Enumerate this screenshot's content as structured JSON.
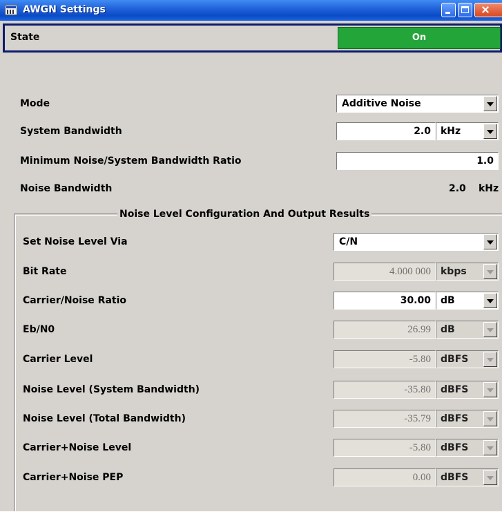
{
  "window": {
    "title": "AWGN Settings",
    "icon": "app-window-icon",
    "controls": [
      "minimize-icon",
      "maximize-icon",
      "close-icon"
    ]
  },
  "state": {
    "label": "State",
    "value": "On",
    "color": "#23a53a"
  },
  "mode": {
    "label": "Mode",
    "value": "Additive Noise"
  },
  "system_bandwidth": {
    "label": "System Bandwidth",
    "value": "2.0",
    "unit": "kHz"
  },
  "min_ratio": {
    "label": "Minimum Noise/System Bandwidth Ratio",
    "value": "1.0"
  },
  "noise_bandwidth": {
    "label": "Noise Bandwidth",
    "value": "2.0",
    "unit": "kHz"
  },
  "group": {
    "title": "Noise Level Configuration And Output Results",
    "set_noise_level_via": {
      "label": "Set Noise Level Via",
      "value": "C/N"
    },
    "rows": [
      {
        "label": "Bit Rate",
        "value": "4.000 000",
        "unit": "kbps",
        "enabled": false
      },
      {
        "label": "Carrier/Noise Ratio",
        "value": "30.00",
        "unit": "dB",
        "enabled": true
      },
      {
        "label": "Eb/N0",
        "value": "26.99",
        "unit": "dB",
        "enabled": false
      },
      {
        "label": "Carrier Level",
        "value": "-5.80",
        "unit": "dBFS",
        "enabled": false
      },
      {
        "label": "Noise Level (System Bandwidth)",
        "value": "-35.80",
        "unit": "dBFS",
        "enabled": false
      },
      {
        "label": "Noise Level (Total Bandwidth)",
        "value": "-35.79",
        "unit": "dBFS",
        "enabled": false
      },
      {
        "label": "Carrier+Noise Level",
        "value": "-5.80",
        "unit": "dBFS",
        "enabled": false
      },
      {
        "label": "Carrier+Noise PEP",
        "value": "0.00",
        "unit": "dBFS",
        "enabled": false
      }
    ]
  }
}
